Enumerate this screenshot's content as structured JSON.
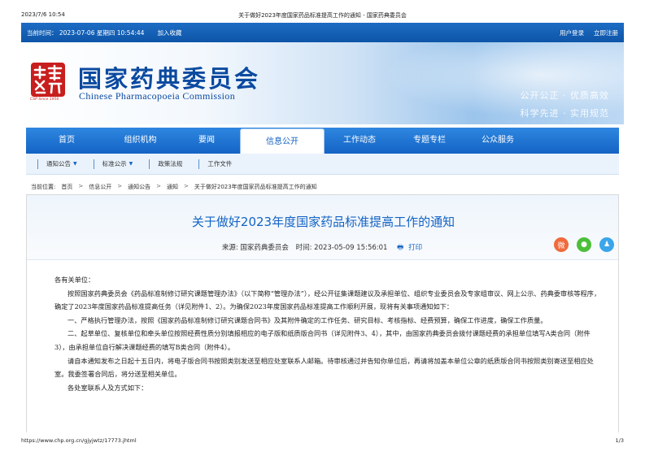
{
  "print_header": {
    "datetime": "2023/7/6 10:54",
    "title": "关于做好2023年度国家药品标准提高工作的通知 - 国家药典委员会"
  },
  "topbar": {
    "time_label": "当前时间：  2023-07-06 星期四 10:54:44",
    "favorite": "加入收藏",
    "login": "用户登录",
    "register": "立即注册"
  },
  "banner": {
    "logo_since": "CSP Since 1950",
    "name_cn": "国家药典委员会",
    "name_en": "Chinese Pharmacopoeia Commission",
    "slogan_1": "公开公正 · 优质高效",
    "slogan_2": "科学先进 · 实用规范"
  },
  "nav": {
    "items": [
      "首页",
      "组织机构",
      "要闻",
      "信息公开",
      "工作动态",
      "专题专栏",
      "公众服务"
    ],
    "active": "信息公开"
  },
  "subnav": {
    "items": [
      "通知公告",
      "标准公示",
      "政策法规",
      "工作文件"
    ]
  },
  "breadcrumb": {
    "label": "当前位置:",
    "items": [
      "首页",
      "信息公开",
      "通知公告",
      "通知",
      "关于做好2023年度国家药品标准提高工作的通知"
    ]
  },
  "article": {
    "title": "关于做好2023年度国家药品标准提高工作的通知",
    "source": "来源:  国家药典委员会",
    "time": "时间:  2023-05-09 15:56:01",
    "print": "打印",
    "paragraphs": [
      "各有关单位：",
      "按照国家药典委员会《药品标准制修订研究课题管理办法》（以下简称“管理办法”），经公开征集课题建议及承担单位、组织专业委员会及专家组审议、网上公示、药典委审核等程序，确定了2023年度国家药品标准提高任务（详见附件1、2）。为确保2023年度国家药品标准提高工作顺利开展，现将有关事项通知如下：",
      "一、严格执行管理办法，按照《国家药品标准制修订研究课题合同书》及其附件确定的工作任务、研究目标、考核指标、经费预算，确保工作进度，确保工作质量。",
      "二、起草单位、复核单位和牵头单位按照经费性质分别填报相应的电子版和纸质版合同书（详见附件3、4），其中，由国家药典委员会拨付课题经费的承担单位填写A类合同（附件3），由承担单位自行解决课题经费的填写B类合同（附件4）。",
      "请自本通知发布之日起十五日内，将电子版合同书按照类别发送至相应处室联系人邮箱。待审核通过并告知你单位后，再请将加盖本单位公章的纸质版合同书按照类别寄送至相应处室。我委签署合同后，将分送至相关单位。",
      "各处室联系人及方式如下："
    ]
  },
  "print_footer": {
    "url": "https://www.chp.org.cn/gjyjwtz/17773.jhtml",
    "page": "1/3"
  },
  "colors": {
    "brand_blue": "#1463c4",
    "logo_red": "#c81e1e"
  }
}
